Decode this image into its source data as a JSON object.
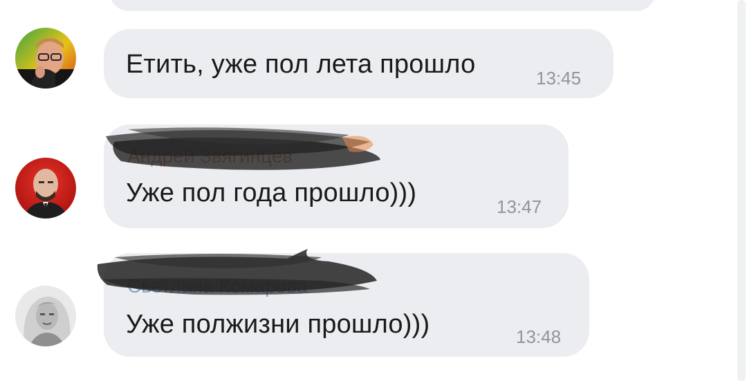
{
  "messages": [
    {
      "text": "Етить, уже пол лета прошло",
      "time": "13:45",
      "avatar_icon": "avatar-man-glasses"
    },
    {
      "sender": "Андрей Звягинцев",
      "sender_color": "#d9471f",
      "text": "Уже пол года прошло)))",
      "time": "13:47",
      "avatar_icon": "avatar-bald-man"
    },
    {
      "sender": "Светлана Комарова",
      "sender_color": "#2a6db5",
      "text": "Уже полжизни прошло)))",
      "time": "13:48",
      "avatar_icon": "avatar-woman-blonde"
    }
  ],
  "colors": {
    "bubble_bg": "#ebedf0",
    "text": "#1a1a1a",
    "time": "#8e959c",
    "redaction": "#1c1c1c"
  }
}
